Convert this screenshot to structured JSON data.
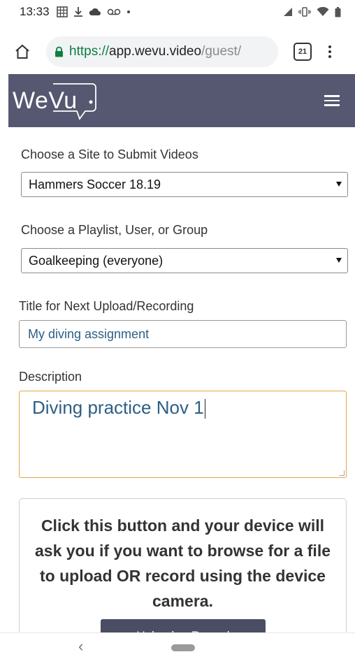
{
  "status_bar": {
    "time": "13:33",
    "left_icons": [
      "calendar-grid-icon",
      "download-icon",
      "cloud-icon",
      "voicemail-icon",
      "dot-icon"
    ],
    "right_icons": [
      "signal-icon",
      "vibrate-icon",
      "wifi-icon",
      "battery-icon"
    ]
  },
  "browser": {
    "url_scheme": "https://",
    "url_host": "app.wevu.video",
    "url_path": "/guest/",
    "tab_count": "21"
  },
  "header": {
    "logo": "WeVu"
  },
  "form": {
    "site_label": "Choose a Site to Submit Videos",
    "site_value": "Hammers Soccer 18.19",
    "playlist_label": "Choose a Playlist, User, or Group",
    "playlist_value": "Goalkeeping (everyone)",
    "title_label": "Title for Next Upload/Recording",
    "title_value": "My diving assignment",
    "description_label": "Description",
    "description_value": "Diving practice Nov 1"
  },
  "info": {
    "text": "Click this button and your device will ask you if you want to browse for a file to upload OR record using the device camera.",
    "upload_button": "Upload or Record"
  },
  "nav": {
    "back_glyph": "‹"
  },
  "colors": {
    "header_bg": "#555870",
    "focus_border": "#e2a646",
    "input_text": "#2c5f86",
    "button_bg": "#4a4d63"
  }
}
